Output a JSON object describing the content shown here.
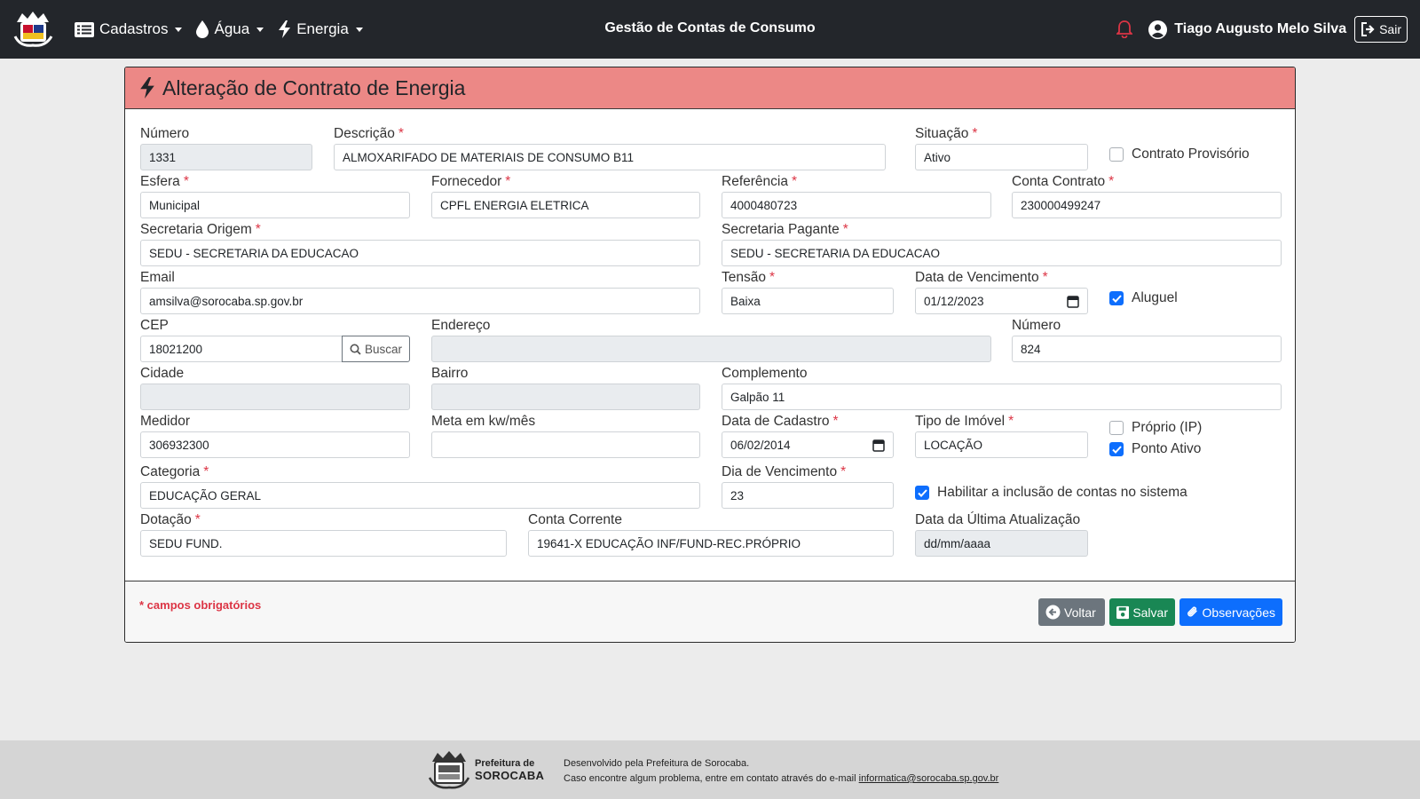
{
  "navbar": {
    "menu": [
      {
        "label": "Cadastros",
        "icon": "list-icon"
      },
      {
        "label": "Água",
        "icon": "droplet-icon"
      },
      {
        "label": "Energia",
        "icon": "bolt-icon"
      }
    ],
    "title": "Gestão de Contas de Consumo",
    "user_name": "Tiago Augusto Melo Silva",
    "logout_label": "Sair",
    "bell_color": "#dc3545"
  },
  "form": {
    "title": "Alteração de Contrato de Energia",
    "header_color": "#ec8886",
    "required_mark": "*",
    "fields": {
      "numero": {
        "label": "Número",
        "value": "1331"
      },
      "descricao": {
        "label": "Descrição",
        "value": "ALMOXARIFADO DE MATERIAIS DE CONSUMO B11"
      },
      "situacao": {
        "label": "Situação",
        "value": "Ativo"
      },
      "esfera": {
        "label": "Esfera",
        "value": "Municipal"
      },
      "fornecedor": {
        "label": "Fornecedor",
        "value": "CPFL ENERGIA ELETRICA"
      },
      "referencia": {
        "label": "Referência",
        "value": "4000480723"
      },
      "conta_contrato": {
        "label": "Conta Contrato",
        "value": "230000499247"
      },
      "secretaria_origem": {
        "label": "Secretaria Origem",
        "value": "SEDU - SECRETARIA DA EDUCACAO"
      },
      "secretaria_pagante": {
        "label": "Secretaria Pagante",
        "value": "SEDU - SECRETARIA DA EDUCACAO"
      },
      "email": {
        "label": "Email",
        "value": "amsilva@sorocaba.sp.gov.br"
      },
      "tensao": {
        "label": "Tensão",
        "value": "Baixa"
      },
      "data_vencimento": {
        "label": "Data de Vencimento",
        "value": "01/12/2023"
      },
      "cep": {
        "label": "CEP",
        "value": "18021200"
      },
      "endereco": {
        "label": "Endereço",
        "value": ""
      },
      "numero_end": {
        "label": "Número",
        "value": "824"
      },
      "cidade": {
        "label": "Cidade",
        "value": ""
      },
      "bairro": {
        "label": "Bairro",
        "value": ""
      },
      "complemento": {
        "label": "Complemento",
        "value": "Galpão 11"
      },
      "medidor": {
        "label": "Medidor",
        "value": "306932300"
      },
      "meta": {
        "label": "Meta em kw/mês",
        "value": ""
      },
      "data_cadastro": {
        "label": "Data de Cadastro",
        "value": "06/02/2014"
      },
      "tipo_imovel": {
        "label": "Tipo de Imóvel",
        "value": "LOCAÇÃO"
      },
      "categoria": {
        "label": "Categoria",
        "value": "EDUCAÇÃO GERAL"
      },
      "dia_vencimento": {
        "label": "Dia de Vencimento",
        "value": "23"
      },
      "dotacao": {
        "label": "Dotação",
        "value": "SEDU FUND."
      },
      "conta_corrente": {
        "label": "Conta Corrente",
        "value": "19641-X EDUCAÇÃO INF/FUND-REC.PRÓPRIO"
      },
      "ultima_atualizacao": {
        "label": "Data da Última Atualização",
        "value": "dd/mm/aaaa"
      }
    },
    "checkboxes": {
      "contrato_provisorio": {
        "label": "Contrato Provisório",
        "checked": false
      },
      "aluguel": {
        "label": "Aluguel",
        "checked": true
      },
      "proprio_ip": {
        "label": "Próprio (IP)",
        "checked": false
      },
      "ponto_ativo": {
        "label": "Ponto Ativo",
        "checked": true
      },
      "habilitar_contas": {
        "label": "Habilitar a inclusão de contas no sistema",
        "checked": true
      }
    },
    "buscar_label": "Buscar",
    "footnote": "* campos obrigatórios",
    "buttons": {
      "voltar": "Voltar",
      "salvar": "Salvar",
      "observacoes": "Observações"
    }
  },
  "footer": {
    "brand_line1": "Prefeitura de",
    "brand_line2": "SOROCABA",
    "line1": "Desenvolvido pela Prefeitura de Sorocaba.",
    "line2_prefix": "Caso encontre algum problema, entre em contato através do e-mail",
    "email": "informatica@sorocaba.sp.gov.br"
  }
}
